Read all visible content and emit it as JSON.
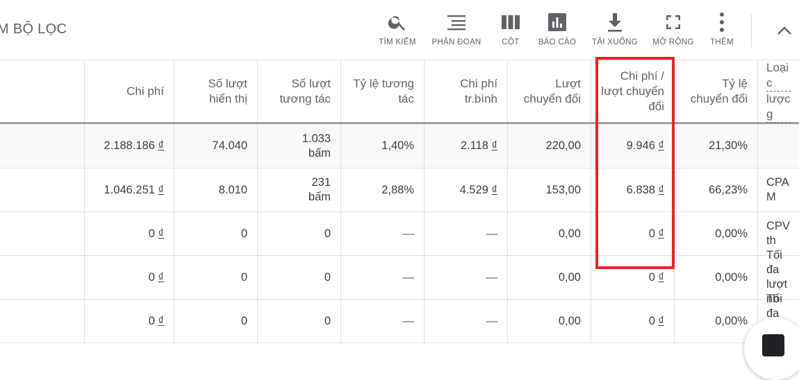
{
  "toolbar": {
    "filter_title": "M BỘ LỌC",
    "tools": [
      {
        "label": "TÌM KIẾM",
        "icon": "search-icon"
      },
      {
        "label": "PHÂN ĐOẠN",
        "icon": "segment-icon"
      },
      {
        "label": "CỘT",
        "icon": "columns-icon"
      },
      {
        "label": "BÁO CÁO",
        "icon": "report-icon"
      },
      {
        "label": "TẢI XUỐNG",
        "icon": "download-icon"
      },
      {
        "label": "MỞ RỘNG",
        "icon": "expand-icon"
      },
      {
        "label": "THÊM",
        "icon": "more-vert-icon"
      }
    ],
    "collapse_icon": "chevron-up-icon"
  },
  "table": {
    "headers": {
      "cost": [
        "Chi phí"
      ],
      "impressions": [
        "Số lượt",
        "hiển thị"
      ],
      "interactions": [
        "Số lượt",
        "tương tác"
      ],
      "interaction_rate": [
        "Tỷ lệ tương",
        "tác"
      ],
      "avg_cost": [
        "Chi phí",
        "tr.bình"
      ],
      "conversions": [
        "Lượt",
        "chuyển đổi"
      ],
      "cost_per_conv": [
        "Chi phí /",
        "lượt chuyển",
        "đổi"
      ],
      "conv_rate": [
        "Tỷ lệ",
        "chuyển đổi"
      ],
      "bid_strategy": [
        "Loại c",
        "lược g"
      ]
    },
    "total": {
      "cost": "2.188.186",
      "impressions": "74.040",
      "interactions": [
        "1.033",
        "bấm"
      ],
      "interaction_rate": "1,40%",
      "avg_cost": "2.118",
      "conversions": "220,00",
      "cost_per_conv": "9.946",
      "conv_rate": "21,30%",
      "bid_strategy": ""
    },
    "rows": [
      {
        "cost": "1.046.251",
        "impressions": "8.010",
        "interactions": [
          "231",
          "bấm"
        ],
        "interaction_rate": "2,88%",
        "avg_cost": "4.529",
        "conversions": "153,00",
        "cost_per_conv": "6.838",
        "conv_rate": "66,23%",
        "bid_strategy": [
          "CPA M"
        ]
      },
      {
        "cost": "0",
        "impressions": "0",
        "interactions": [
          "0"
        ],
        "interaction_rate": "—",
        "avg_cost": "—",
        "conversions": "0,00",
        "cost_per_conv": "0",
        "conv_rate": "0,00%",
        "bid_strategy": [
          "CPV th"
        ]
      },
      {
        "cost": "0",
        "impressions": "0",
        "interactions": [
          "0"
        ],
        "interaction_rate": "—",
        "avg_cost": "—",
        "conversions": "0,00",
        "cost_per_conv": "0",
        "conv_rate": "0,00%",
        "bid_strategy": [
          "Tối đa",
          "lượt nh"
        ]
      },
      {
        "cost": "0",
        "impressions": "0",
        "interactions": [
          "0"
        ],
        "interaction_rate": "—",
        "avg_cost": "—",
        "conversions": "0,00",
        "cost_per_conv": "0",
        "conv_rate": "0,00%",
        "bid_strategy": [
          "Tối đa",
          "lượt nh"
        ]
      }
    ],
    "currency_symbol": "₫"
  },
  "colors": {
    "highlight": "#e0282b",
    "link": "#1a73e8",
    "text": "#3c4043"
  }
}
